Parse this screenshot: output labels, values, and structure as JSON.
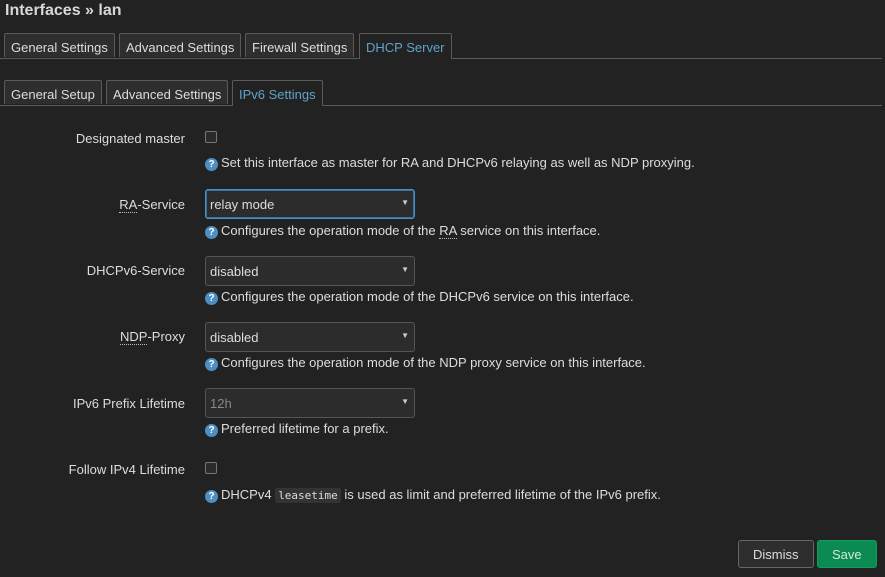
{
  "header": {
    "title": "Interfaces » lan"
  },
  "tabs": [
    {
      "label": "General Settings"
    },
    {
      "label": "Advanced Settings"
    },
    {
      "label": "Firewall Settings"
    },
    {
      "label": "DHCP Server"
    }
  ],
  "subtabs": [
    {
      "label": "General Setup"
    },
    {
      "label": "Advanced Settings"
    },
    {
      "label": "IPv6 Settings"
    }
  ],
  "fields": {
    "designated_master": {
      "label": "Designated master",
      "checked": false,
      "help": "Set this interface as master for RA and DHCPv6 relaying as well as NDP proxying."
    },
    "ra_service": {
      "label_abbr": "RA",
      "label_rest": "-Service",
      "value": "relay mode",
      "help_pre": "Configures the operation mode of the ",
      "help_abbr": "RA",
      "help_post": " service on this interface."
    },
    "dhcpv6_service": {
      "label": "DHCPv6-Service",
      "value": "disabled",
      "help": "Configures the operation mode of the DHCPv6 service on this interface."
    },
    "ndp_proxy": {
      "label_abbr": "NDP",
      "label_rest": "-Proxy",
      "value": "disabled",
      "help": "Configures the operation mode of the NDP proxy service on this interface."
    },
    "ipv6_prefix_lifetime": {
      "label": "IPv6 Prefix Lifetime",
      "value": "12h",
      "help": "Preferred lifetime for a prefix."
    },
    "follow_ipv4_lifetime": {
      "label": "Follow IPv4 Lifetime",
      "checked": false,
      "help_pre": "DHCPv4 ",
      "help_code": "leasetime",
      "help_post": " is used as limit and preferred lifetime of the IPv6 prefix."
    }
  },
  "actions": {
    "dismiss": "Dismiss",
    "save": "Save"
  },
  "colors": {
    "accent": "#5fa3c9",
    "save": "#0b8a52",
    "help_icon": "#4d8fc2"
  },
  "icons": {
    "help": "help-icon",
    "caret": "chevron-down-icon"
  }
}
